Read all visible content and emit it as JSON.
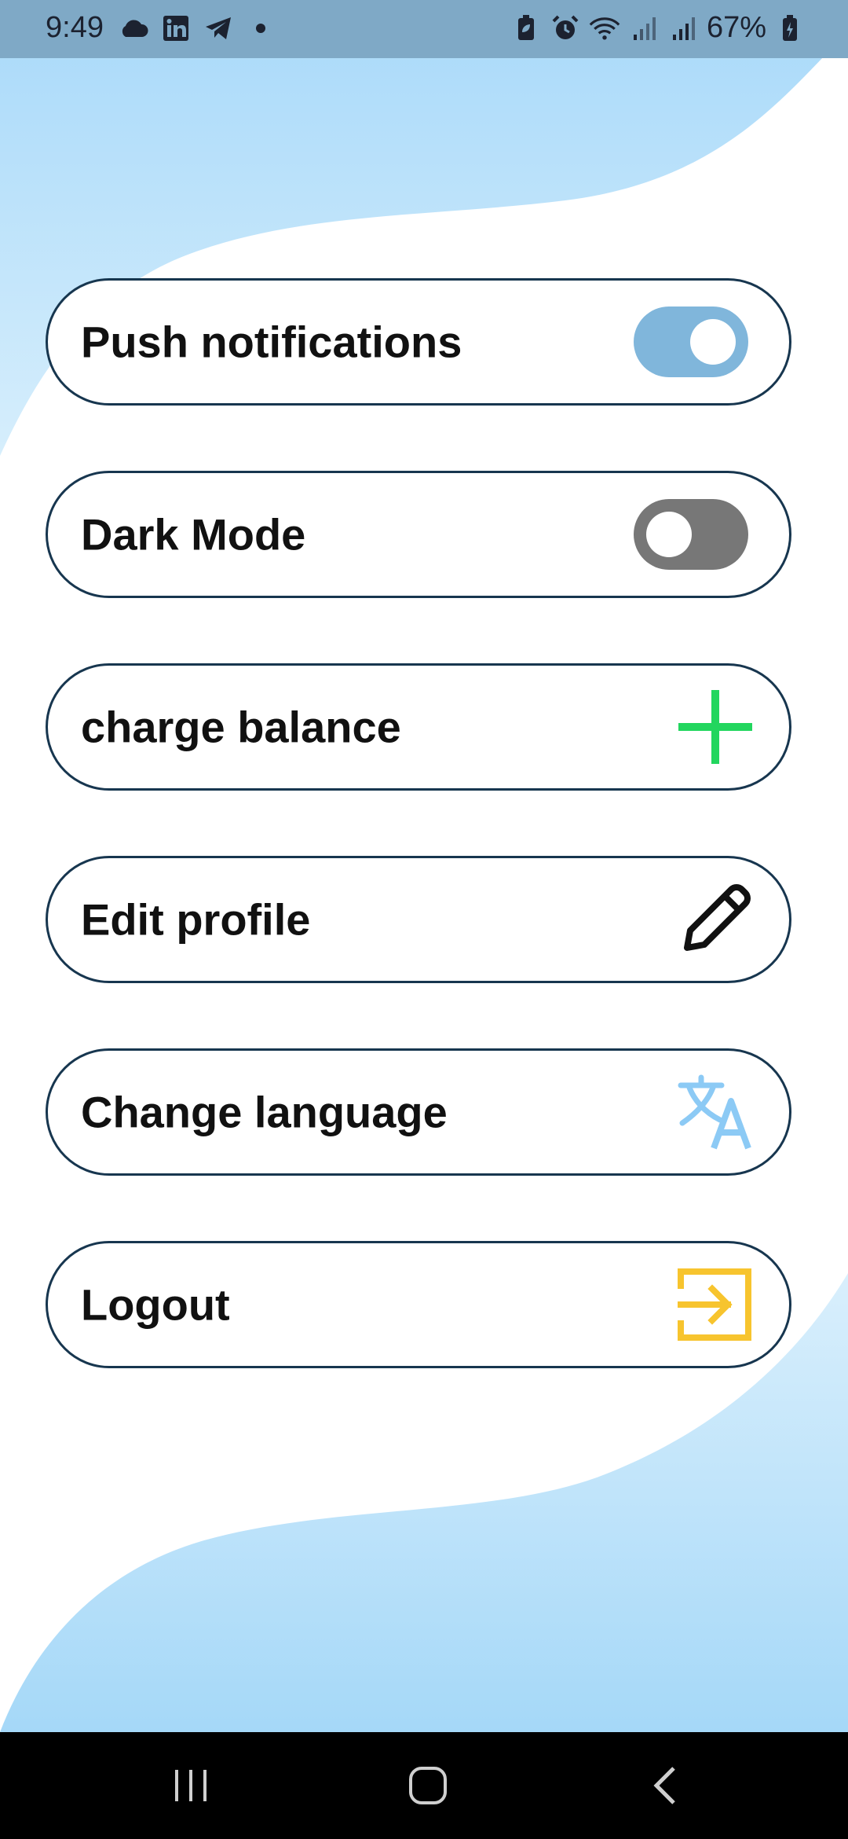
{
  "status_bar": {
    "time": "9:49",
    "battery": "67%",
    "left_icons": [
      "cloud-icon",
      "linkedin-icon",
      "telegram-icon",
      "dot-icon"
    ],
    "right_icons": [
      "battery-saver-icon",
      "alarm-icon",
      "wifi-icon",
      "signal-icon",
      "signal-icon",
      "battery-icon"
    ]
  },
  "settings": [
    {
      "label": "Push notifications",
      "control": "toggle",
      "checked": true
    },
    {
      "label": "Dark Mode",
      "control": "toggle",
      "checked": false
    },
    {
      "label": "charge balance",
      "control": "icon",
      "icon": "plus-icon"
    },
    {
      "label": "Edit profile",
      "control": "icon",
      "icon": "pencil-icon"
    },
    {
      "label": "Change language",
      "control": "icon",
      "icon": "translate-icon"
    },
    {
      "label": "Logout",
      "control": "icon",
      "icon": "logout-icon"
    }
  ],
  "colors": {
    "wave": "#aedcf8",
    "toggle_on": "#80b6db",
    "toggle_off": "#777777",
    "plus": "#22d65e",
    "translate": "#8ccaf5",
    "logout": "#f7c42e",
    "border": "#17364f"
  },
  "nav_bar": {
    "buttons": [
      "recent-apps-button",
      "home-button",
      "back-button"
    ]
  }
}
